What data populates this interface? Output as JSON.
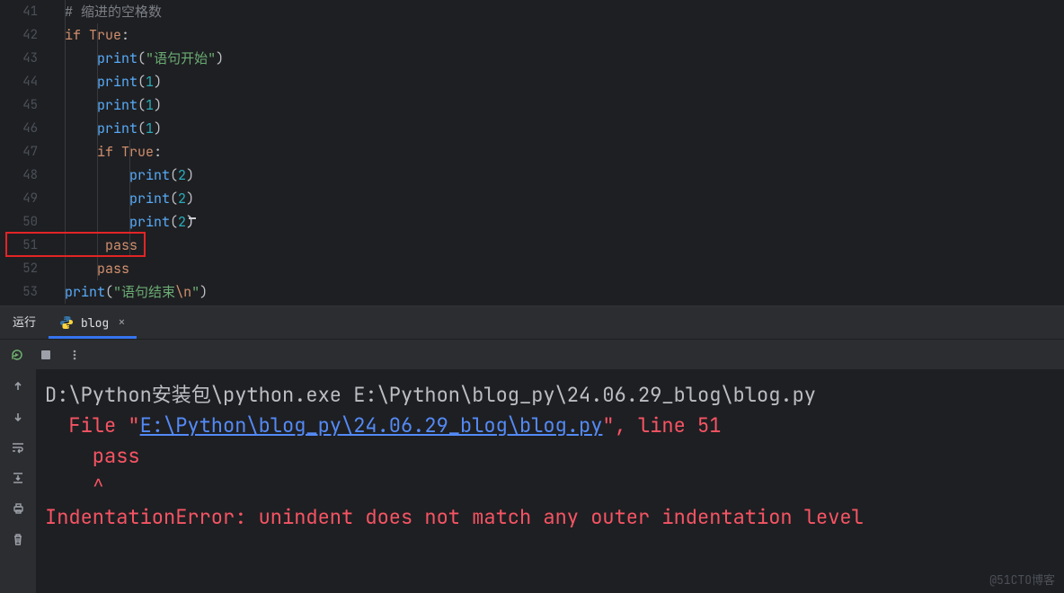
{
  "editor": {
    "line_numbers": [
      "41",
      "42",
      "43",
      "44",
      "45",
      "46",
      "47",
      "48",
      "49",
      "50",
      "51",
      "52",
      "53"
    ],
    "lines": {
      "l41": {
        "indent0": "",
        "hash": "# ",
        "comment": "缩进的空格数"
      },
      "l42": {
        "kw": "if",
        "sp": " ",
        "bool": "True",
        "colon": ":"
      },
      "l43": {
        "fn": "print",
        "op": "(",
        "q1": "\"",
        "str": "语句开始",
        "q2": "\"",
        "cp": ")"
      },
      "l44": {
        "fn": "print",
        "op": "(",
        "num": "1",
        "cp": ")"
      },
      "l45": {
        "fn": "print",
        "op": "(",
        "num": "1",
        "cp": ")"
      },
      "l46": {
        "fn": "print",
        "op": "(",
        "num": "1",
        "cp": ")"
      },
      "l47": {
        "kw": "if",
        "sp": " ",
        "bool": "True",
        "colon": ":"
      },
      "l48": {
        "fn": "print",
        "op": "(",
        "num": "2",
        "cp": ")"
      },
      "l49": {
        "fn": "print",
        "op": "(",
        "num": "2",
        "cp": ")"
      },
      "l50": {
        "fn": "print",
        "op": "(",
        "num": "2",
        "cp": ")"
      },
      "l51": {
        "kw": "pass"
      },
      "l52": {
        "kw": "pass"
      },
      "l53": {
        "fn": "print",
        "op": "(",
        "q1": "\"",
        "str": "语句结束",
        "esc": "\\n",
        "q2": "\"",
        "cp": ")"
      }
    },
    "highlight_line": "51"
  },
  "tabs": {
    "run_label": "运行",
    "tab_name": "blog",
    "close": "×"
  },
  "terminal": {
    "cmd_pre": "D:\\Python安装包\\python.exe ",
    "cmd_arg": "E:\\Python\\blog_py\\24.06.29_blog\\blog.py",
    "file_pre": "  File ",
    "q": "\"",
    "file_link": "E:\\Python\\blog_py\\24.06.29_blog\\blog.py",
    "file_post": ", line 51",
    "err_line": "    pass",
    "caret_line": "    ^",
    "blank": "",
    "error": "IndentationError: unindent does not match any outer indentation level"
  },
  "watermark": "@51CTO博客"
}
